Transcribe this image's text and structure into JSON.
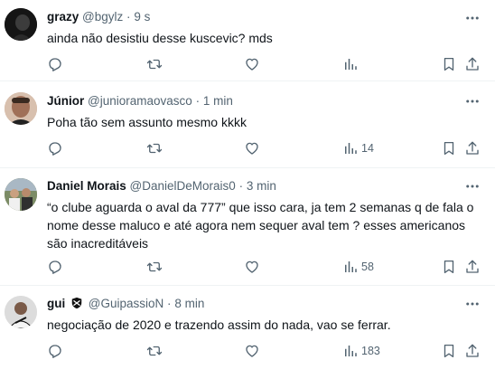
{
  "tweets": [
    {
      "name": "grazy",
      "handle": "@bgylz",
      "time": "9 s",
      "text": "ainda não desistiu desse kuscevic? mds",
      "views": ""
    },
    {
      "name": "Júnior",
      "handle": "@junioramaovasco",
      "time": "1 min",
      "text": "Poha tão sem assunto mesmo kkkk",
      "views": "14"
    },
    {
      "name": "Daniel Morais",
      "handle": "@DanielDeMorais0",
      "time": "3 min",
      "text": "“o clube aguarda o aval da 777” que isso cara, ja tem 2 semanas q de fala o nome desse maluco e até agora nem sequer aval tem ? esses americanos são inacreditáveis",
      "views": "58"
    },
    {
      "name": "gui",
      "handle": "@GuipassioN",
      "time": "8 min",
      "text": "negociação de 2020 e trazendo assim do nada, vao se ferrar.",
      "views": "183"
    }
  ],
  "separator": "·",
  "colors": {
    "text": "#0f1419",
    "muted": "#536471",
    "border": "#eff3f4"
  },
  "icons": [
    "reply-icon",
    "retweet-icon",
    "like-icon",
    "views-icon",
    "bookmark-icon",
    "share-icon",
    "more-icon",
    "club-badge-icon"
  ]
}
